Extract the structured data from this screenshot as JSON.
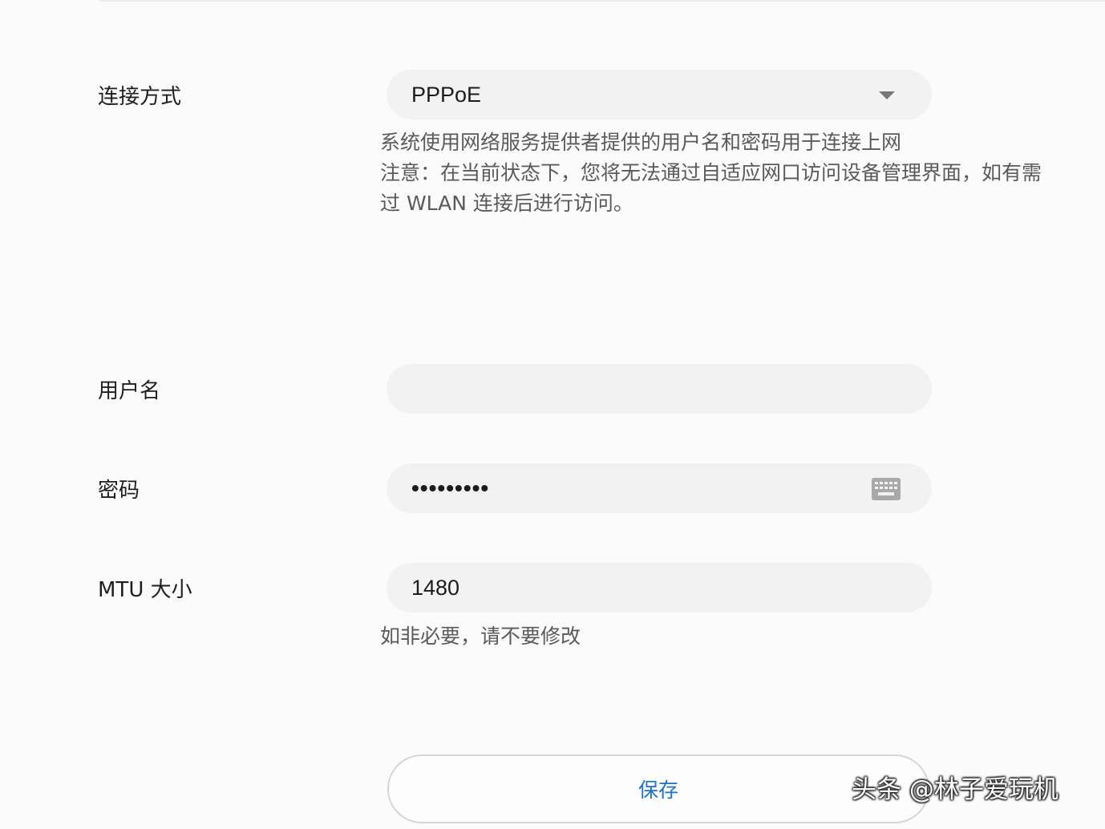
{
  "connection": {
    "label": "连接方式",
    "selected_value": "PPPoE",
    "hint_line1": "系统使用网络服务提供者提供的用户名和密码用于连接上网",
    "hint_line2": "注意：在当前状态下，您将无法通过自适应网口访问设备管理界面，如有需",
    "hint_line3": "过 WLAN 连接后进行访问。"
  },
  "username": {
    "label": "用户名",
    "value": ""
  },
  "password": {
    "label": "密码",
    "masked_value": "•••••••••"
  },
  "mtu": {
    "label": "MTU 大小",
    "value": "1480",
    "hint": "如非必要，请不要修改"
  },
  "actions": {
    "save_label": "保存"
  },
  "watermark": {
    "text": "头条 @林子爱玩机"
  },
  "colors": {
    "accent": "#1a73c9",
    "field_background": "#f2f2f2",
    "page_background": "#fbfbfb"
  }
}
